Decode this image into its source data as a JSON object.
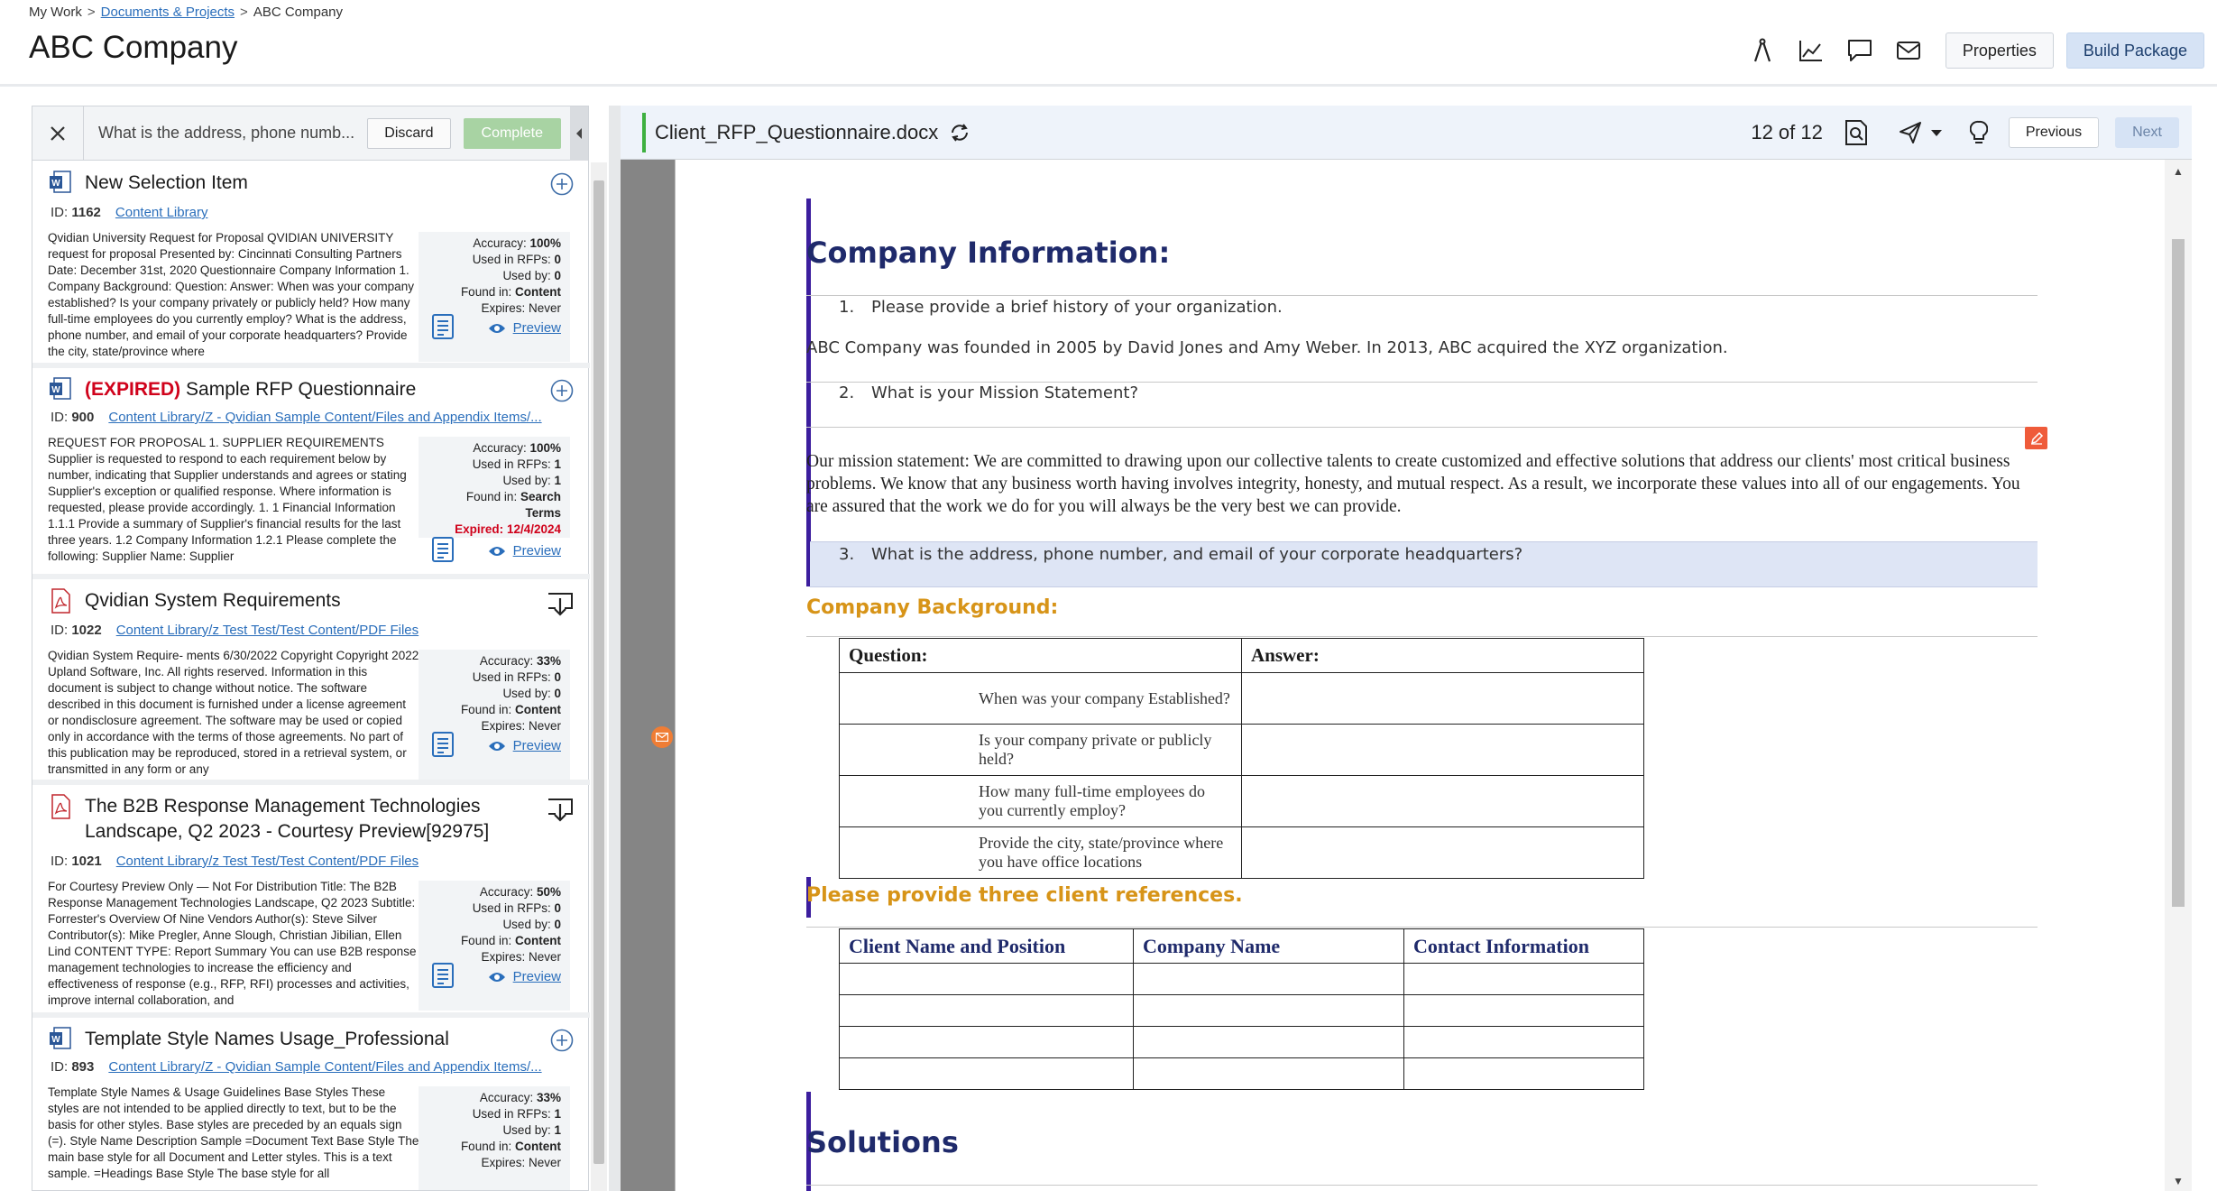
{
  "breadcrumb": {
    "home": "My Work",
    "parent": "Documents & Projects",
    "current": "ABC Company",
    "sep": ">"
  },
  "page_title": "ABC Company",
  "header": {
    "icons": [
      "compass-icon",
      "analytics-icon",
      "comment-icon",
      "mail-icon"
    ],
    "properties_label": "Properties",
    "build_package_label": "Build Package"
  },
  "left_panel": {
    "query": "What is the address, phone numb...",
    "discard_label": "Discard",
    "complete_label": "Complete",
    "results": [
      {
        "icon": "word-doc-icon",
        "expired_tag": "",
        "title": "New Selection Item",
        "id_label": "ID:",
        "id": "1162",
        "path": "Content Library",
        "action_icon": "add-circle-icon",
        "snippet": "Qvidian University Request for Proposal QVIDIAN UNIVERSITY request for proposal Presented by: Cincinnati Consulting Partners Date: December 31st, 2020 Questionnaire Company Information 1. Company Background: Question: Answer: When was your company established? Is your company privately or publicly held? How many full-time employees do you currently employ? What is the address, phone number, and email of your corporate headquarters? Provide the city, state/province where",
        "stats": [
          {
            "k": "Accuracy:",
            "v": "100%"
          },
          {
            "k": "Used in RFPs:",
            "v": "0"
          },
          {
            "k": "Used by:",
            "v": "0"
          },
          {
            "k": "Found in:",
            "v": "Content"
          },
          {
            "k": "Expires:",
            "v": "Never",
            "plain": true
          }
        ],
        "preview_label": "Preview"
      },
      {
        "icon": "word-doc-icon",
        "expired_tag": "(EXPIRED)",
        "title": "Sample RFP Questionnaire",
        "id_label": "ID:",
        "id": "900",
        "path": "Content Library/Z - Qvidian Sample Content/Files and Appendix Items/...",
        "action_icon": "add-circle-icon",
        "snippet": "REQUEST FOR PROPOSAL 1. SUPPLIER REQUIREMENTS Supplier is requested to respond to each requirement below by number, indicating that Supplier understands and agrees or stating Supplier's exception or qualified response. Where information is requested, please provide accordingly. 1. 1 Financial Information 1.1.1 Provide a summary of Supplier's financial results for the last three years. 1.2 Company Information 1.2.1 Please complete the following: Supplier Name: Supplier",
        "stats": [
          {
            "k": "Accuracy:",
            "v": "100%"
          },
          {
            "k": "Used in RFPs:",
            "v": "1"
          },
          {
            "k": "Used by:",
            "v": "1"
          },
          {
            "k": "Found in:",
            "v": "Search"
          },
          {
            "k": "",
            "v": "Terms"
          },
          {
            "k": "Expired:",
            "v": "12/4/2024",
            "expired": true
          }
        ],
        "preview_label": "Preview"
      },
      {
        "icon": "pdf-icon",
        "expired_tag": "",
        "title": "Qvidian System Requirements",
        "id_label": "ID:",
        "id": "1022",
        "path": "Content Library/z Test Test/Test Content/PDF Files",
        "action_icon": "download-icon",
        "snippet": "Qvidian System Require- ments 6/30/2022 Copyright Copyright 2022 Upland Software, Inc. All rights reserved. Information in this document is subject to change without notice. The software described in this document is furnished under a license agreement or nondisclosure agreement. The software may be used or copied only in accordance with the terms of those agreements. No part of this publication may be reproduced, stored in a retrieval system, or transmitted in any form or any",
        "stats": [
          {
            "k": "Accuracy:",
            "v": "33%"
          },
          {
            "k": "Used in RFPs:",
            "v": "0"
          },
          {
            "k": "Used by:",
            "v": "0"
          },
          {
            "k": "Found in:",
            "v": "Content"
          },
          {
            "k": "Expires:",
            "v": "Never",
            "plain": true
          }
        ],
        "preview_label": "Preview"
      },
      {
        "icon": "pdf-icon",
        "expired_tag": "",
        "title": "The B2B Response Management Technologies Landscape, Q2 2023 - Courtesy Preview[92975]",
        "id_label": "ID:",
        "id": "1021",
        "path": "Content Library/z Test Test/Test Content/PDF Files",
        "action_icon": "download-icon",
        "snippet": "For Courtesy Preview Only — Not For Distribution Title: The B2B Response Management Technologies Landscape, Q2 2023 Subtitle: Forrester's Overview Of Nine Vendors Author(s): Steve Silver Contributor(s): Mike Pregler, Anne Slough, Christian Jibilian, Ellen Lind CONTENT TYPE: Report Summary You can use B2B response management technologies to increase the efficiency and effectiveness of response (e.g., RFP, RFI) processes and activities, improve internal collaboration, and",
        "stats": [
          {
            "k": "Accuracy:",
            "v": "50%"
          },
          {
            "k": "Used in RFPs:",
            "v": "0"
          },
          {
            "k": "Used by:",
            "v": "0"
          },
          {
            "k": "Found in:",
            "v": "Content"
          },
          {
            "k": "Expires:",
            "v": "Never",
            "plain": true
          }
        ],
        "preview_label": "Preview"
      },
      {
        "icon": "word-doc-icon",
        "expired_tag": "",
        "title": "Template Style Names Usage_Professional",
        "id_label": "ID:",
        "id": "893",
        "path": "Content Library/Z - Qvidian Sample Content/Files and Appendix Items/...",
        "action_icon": "add-circle-icon",
        "snippet": "Template Style Names & Usage Guidelines Base Styles These styles are not intended to be applied directly to text, but to be the basis for other styles. Base styles are preceded by an equals sign (=). Style Name Description Sample =Document Text Base Style The main base style for all Document and Letter styles. This is a text sample. =Headings Base Style The base style for all",
        "stats": [
          {
            "k": "Accuracy:",
            "v": "33%"
          },
          {
            "k": "Used in RFPs:",
            "v": "1"
          },
          {
            "k": "Used by:",
            "v": "1"
          },
          {
            "k": "Found in:",
            "v": "Content"
          },
          {
            "k": "Expires:",
            "v": "Never",
            "plain": true
          }
        ],
        "preview_label": "Preview"
      }
    ]
  },
  "doc_toolbar": {
    "file_name": "Client_RFP_Questionnaire.docx",
    "page_count": "12 of 12",
    "previous_label": "Previous",
    "next_label": "Next"
  },
  "document": {
    "company_info_heading": "Company Information:",
    "q1_num": "1.",
    "q1": "Please provide a brief history of your organization.",
    "a1": "ABC Company was founded in 2005 by David Jones and Amy Weber. In 2013, ABC acquired the XYZ organization.",
    "q2_num": "2.",
    "q2": "What is your Mission Statement?",
    "mission": "Our mission statement: We are committed to drawing upon our collective talents to create customized and effective solutions that address our clients' most critical business problems. We know that any business worth having involves integrity, honesty, and mutual respect. As a result, we incorporate these values into all of our engagements. You are assured that the work we do for you will always be the very best we can provide.",
    "q3_num": "3.",
    "q3": "What is the address, phone number, and email of your corporate headquarters?",
    "background_heading": "Company Background:",
    "bg_table": {
      "headers": [
        "Question:",
        "Answer:"
      ],
      "rows": [
        "When was your company Established?",
        "Is your company private or publicly held?",
        "How many full-time employees do you currently employ?",
        "Provide the city, state/province where you have office locations"
      ]
    },
    "references_heading": "Please provide three client references.",
    "ref_table": {
      "headers": [
        "Client Name and Position",
        "Company Name",
        "Contact Information"
      ]
    },
    "solutions_heading": "Solutions"
  }
}
